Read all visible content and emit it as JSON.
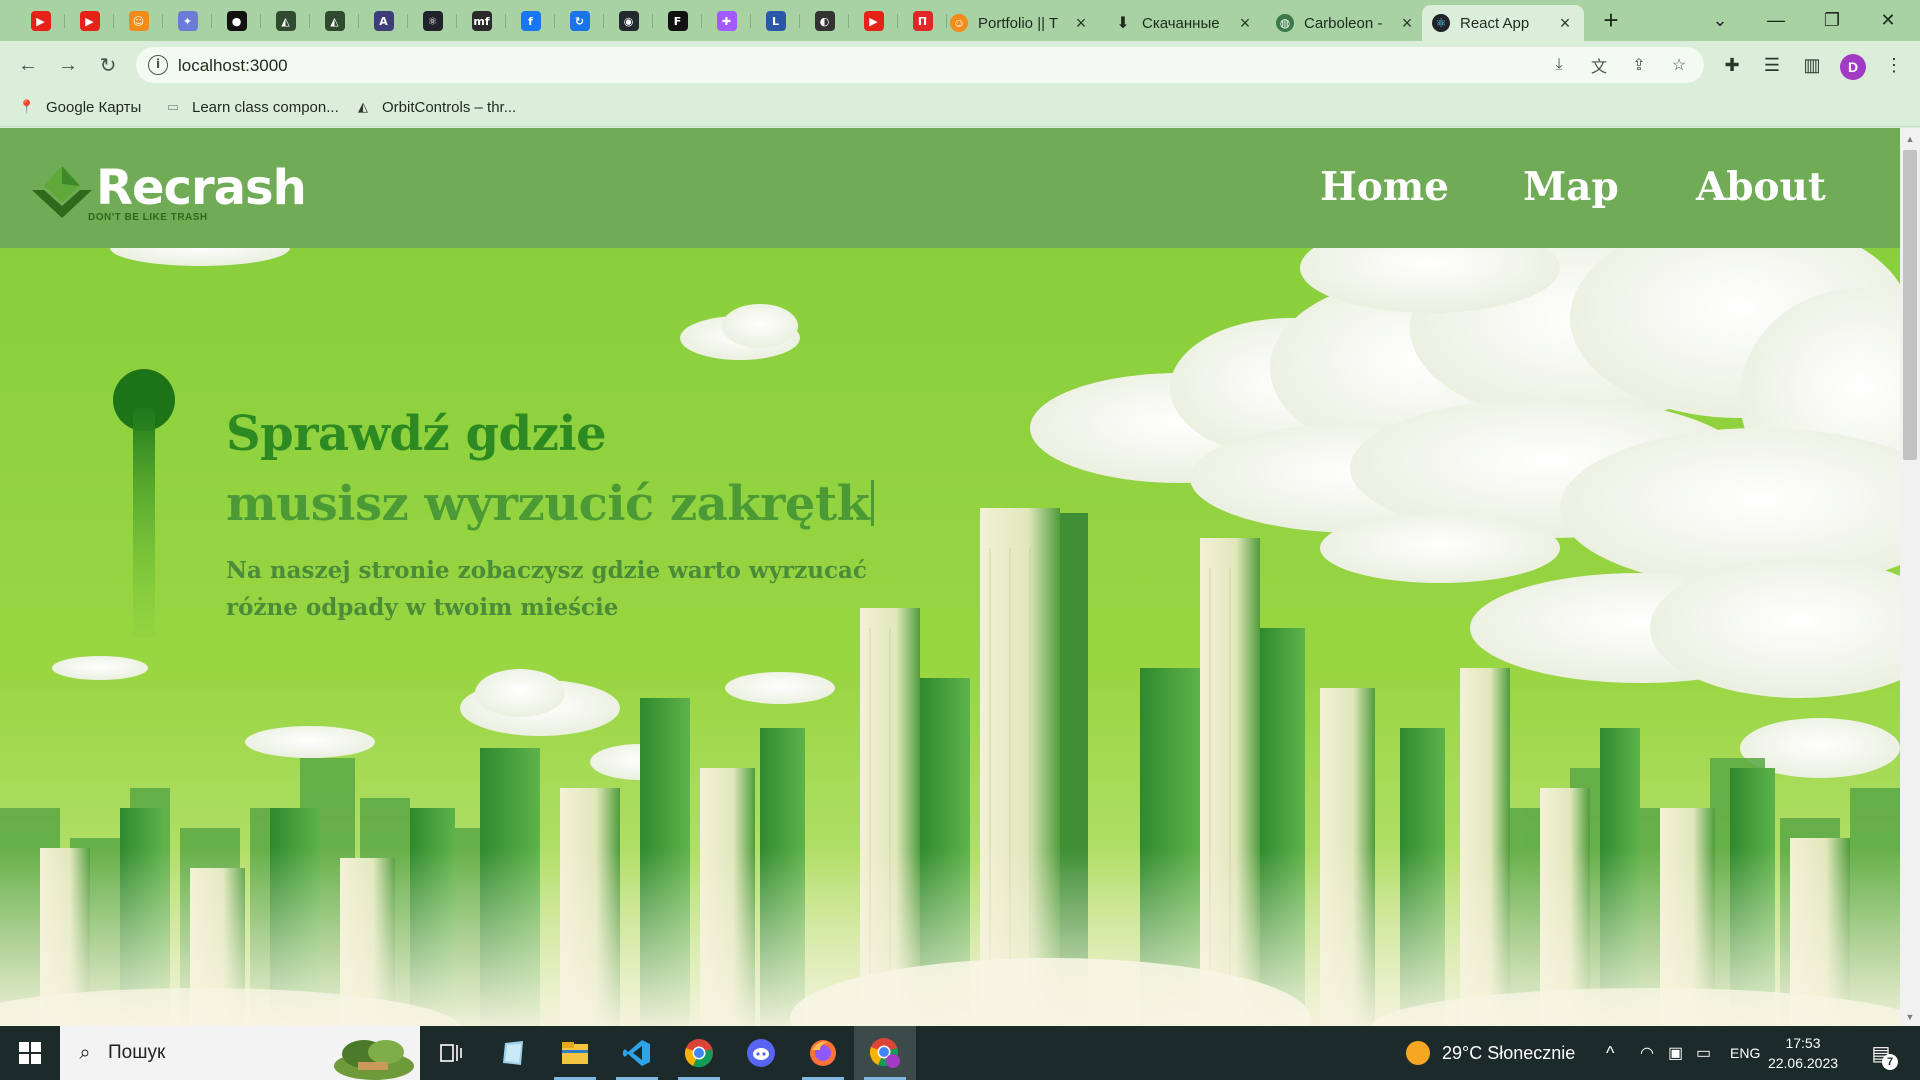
{
  "browser": {
    "pinned_tabs": [
      {
        "name": "youtube-pinned-tab",
        "glyph": "▶",
        "bg": "#e62117"
      },
      {
        "name": "youtube-pinned-tab-2",
        "glyph": "▶",
        "bg": "#e62117"
      },
      {
        "name": "ok-pinned-tab",
        "glyph": "☺",
        "bg": "#f28b17"
      },
      {
        "name": "colorful-pinned-tab",
        "glyph": "✦",
        "bg": "#6b7bd6"
      },
      {
        "name": "black-circle-pinned-tab",
        "glyph": "●",
        "bg": "#111111"
      },
      {
        "name": "triangle-pinned-tab",
        "glyph": "◭",
        "bg": "#2f4a2f"
      },
      {
        "name": "triangle-pinned-tab-2",
        "glyph": "◭",
        "bg": "#2f4a2f"
      },
      {
        "name": "purple-logo-pinned-tab",
        "glyph": "A",
        "bg": "#3d3d7a"
      },
      {
        "name": "react-pinned-tab",
        "glyph": "⚛",
        "bg": "#20232a"
      },
      {
        "name": "mf-pinned-tab",
        "glyph": "mf",
        "bg": "#2a2a2a"
      },
      {
        "name": "facebook-pinned-tab",
        "glyph": "f",
        "bg": "#1877f2"
      },
      {
        "name": "refresh-logo-pinned-tab",
        "glyph": "↻",
        "bg": "#1a73e8"
      },
      {
        "name": "github-pinned-tab",
        "glyph": "◉",
        "bg": "#24292f"
      },
      {
        "name": "framer-pinned-tab",
        "glyph": "F",
        "bg": "#111111"
      },
      {
        "name": "figma-pinned-tab",
        "glyph": "✚",
        "bg": "#a259ff"
      },
      {
        "name": "trello-pinned-tab",
        "glyph": "L",
        "bg": "#2b57a8"
      },
      {
        "name": "globe-pinned-tab",
        "glyph": "◐",
        "bg": "#333333"
      },
      {
        "name": "youtube-pinned-tab-3",
        "glyph": "▶",
        "bg": "#e62117"
      },
      {
        "name": "flipboard-pinned-tab",
        "glyph": "П",
        "bg": "#e12828"
      }
    ],
    "tabs": [
      {
        "label": "Portfolio || T",
        "icon_bg": "#f28b17",
        "icon": "☺"
      },
      {
        "label": "Скачанные",
        "icon_bg": "#333333",
        "icon": "⬇"
      },
      {
        "label": "Carboleon -",
        "icon_bg": "#3a7a4a",
        "icon": "◍"
      },
      {
        "label": "React App",
        "icon_bg": "#20232a",
        "icon": "⚛"
      }
    ],
    "url": "localhost:3000",
    "profile_initial": "D",
    "bookmarks": [
      {
        "label": "Google Карты",
        "icon": "📍"
      },
      {
        "label": "Learn class compon...",
        "icon": "▭"
      },
      {
        "label": "OrbitControls – thr...",
        "icon": "◭"
      }
    ]
  },
  "site": {
    "logo_text": "Recrash",
    "logo_tagline": "DON'T BE LIKE TRASH",
    "nav": {
      "home": "Home",
      "map": "Map",
      "about": "About"
    },
    "hero": {
      "title_line1": "Sprawdź gdzie",
      "title_line2": "musisz wyrzucić  zakrętk",
      "subtitle": "Na naszej stronie zobaczysz gdzie warto wyrzucać różne odpady w twoim mieście"
    },
    "colors": {
      "header": "#6fac55",
      "hero_sky": "#8dd13e",
      "title": "#2d8a22"
    }
  },
  "taskbar": {
    "search_placeholder": "Пошук",
    "weather": "29°C  Słonecznie",
    "language": "ENG",
    "time": "17:53",
    "date": "22.06.2023",
    "notification_count": "7"
  }
}
